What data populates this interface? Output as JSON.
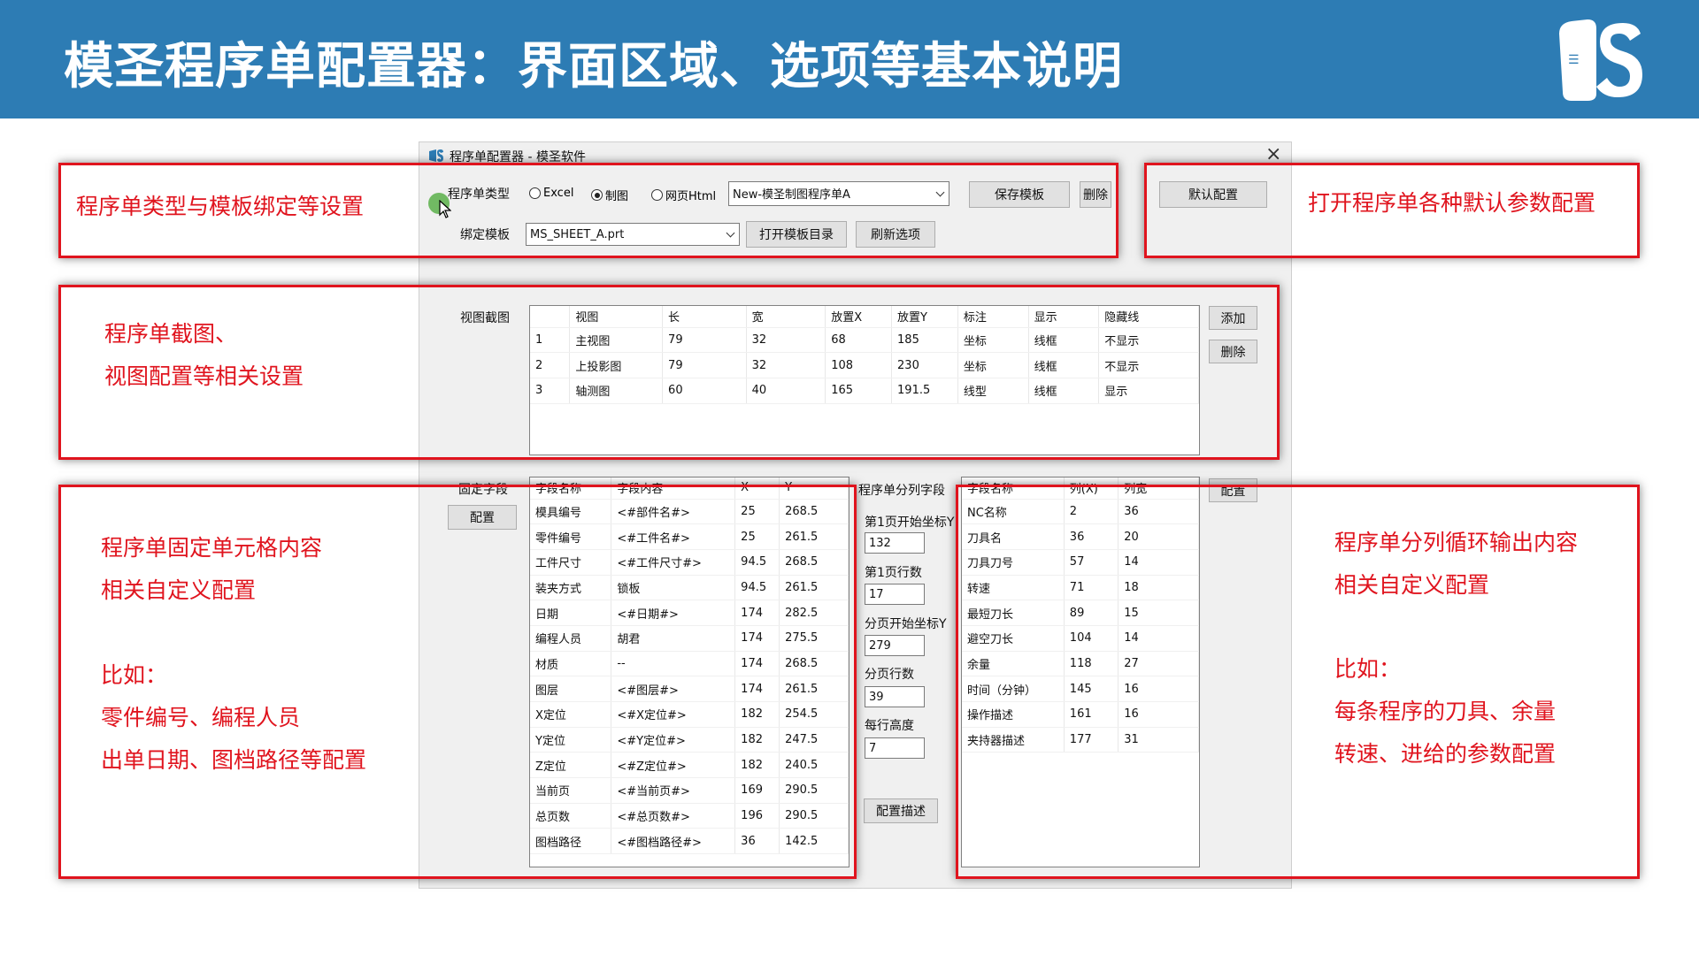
{
  "slide": {
    "title": "模圣程序单配置器：界面区域、选项等基本说明",
    "brand_color": "#2d7cb4",
    "highlight_color": "#e0141e"
  },
  "window": {
    "title": "程序单配置器 - 模圣软件",
    "close_glyph": "×",
    "sheet_type_label": "程序单类型",
    "radio_excel": "Excel",
    "radio_drawing": "制图",
    "radio_html": "网页Html",
    "selected_type": "制图",
    "template_name": "New-模圣制图程序单A",
    "save_template": "保存模板",
    "delete": "删除",
    "default_config": "默认配置",
    "bind_template_label": "绑定模板",
    "bind_template_value": "MS_SHEET_A.prt",
    "open_template_dir": "打开模板目录",
    "refresh_options": "刷新选项",
    "view_capture_label": "视图截图",
    "add": "添加",
    "delete2": "删除",
    "fixed_field_label": "固定字段",
    "config": "配置",
    "split_field_label": "程序单分列字段",
    "first_page_start_y_label": "第1页开始坐标Y",
    "first_page_start_y": "132",
    "first_page_rows_label": "第1页行数",
    "first_page_rows": "17",
    "page_start_y_label": "分页开始坐标Y",
    "page_start_y": "279",
    "page_rows_label": "分页行数",
    "page_rows": "39",
    "row_height_label": "每行高度",
    "row_height": "7",
    "config_desc": "配置描述",
    "config2": "配置"
  },
  "views_table": {
    "headers": [
      "",
      "视图",
      "长",
      "宽",
      "放置X",
      "放置Y",
      "标注",
      "显示",
      "隐藏线"
    ],
    "rows": [
      [
        "1",
        "主视图",
        "79",
        "32",
        "68",
        "185",
        "坐标",
        "线框",
        "不显示"
      ],
      [
        "2",
        "上投影图",
        "79",
        "32",
        "108",
        "230",
        "坐标",
        "线框",
        "不显示"
      ],
      [
        "3",
        "轴测图",
        "60",
        "40",
        "165",
        "191.5",
        "线型",
        "线框",
        "显示"
      ]
    ]
  },
  "fixed_table": {
    "headers": [
      "字段名称",
      "字段内容",
      "X",
      "Y"
    ],
    "rows": [
      [
        "模具编号",
        "<#部件名#>",
        "25",
        "268.5"
      ],
      [
        "零件编号",
        "<#工件名#>",
        "25",
        "261.5"
      ],
      [
        "工件尺寸",
        "<#工件尺寸#>",
        "94.5",
        "268.5"
      ],
      [
        "装夹方式",
        "锁板",
        "94.5",
        "261.5"
      ],
      [
        "日期",
        "<#日期#>",
        "174",
        "282.5"
      ],
      [
        "编程人员",
        "胡君",
        "174",
        "275.5"
      ],
      [
        "材质",
        "--",
        "174",
        "268.5"
      ],
      [
        "图层",
        "<#图层#>",
        "174",
        "261.5"
      ],
      [
        "X定位",
        "<#X定位#>",
        "182",
        "254.5"
      ],
      [
        "Y定位",
        "<#Y定位#>",
        "182",
        "247.5"
      ],
      [
        "Z定位",
        "<#Z定位#>",
        "182",
        "240.5"
      ],
      [
        "当前页",
        "<#当前页#>",
        "169",
        "290.5"
      ],
      [
        "总页数",
        "<#总页数#>",
        "196",
        "290.5"
      ],
      [
        "图档路径",
        "<#图档路径#>",
        "36",
        "142.5"
      ]
    ]
  },
  "split_table": {
    "headers": [
      "字段名称",
      "列(X)",
      "列宽"
    ],
    "rows": [
      [
        "NC名称",
        "2",
        "36"
      ],
      [
        "刀具名",
        "36",
        "20"
      ],
      [
        "刀具刀号",
        "57",
        "14"
      ],
      [
        "转速",
        "71",
        "18"
      ],
      [
        "最短刀长",
        "89",
        "15"
      ],
      [
        "避空刀长",
        "104",
        "14"
      ],
      [
        "余量",
        "118",
        "27"
      ],
      [
        "时间（分钟）",
        "145",
        "16"
      ],
      [
        "操作描述",
        "161",
        "16"
      ],
      [
        "夹持器描述",
        "177",
        "31"
      ]
    ]
  },
  "annotations": {
    "top_left": "程序单类型与模板绑定等设置",
    "top_right": "打开程序单各种默认参数配置",
    "mid_line1": "程序单截图、",
    "mid_line2": "视图配置等相关设置",
    "left_line1": "程序单固定单元格内容",
    "left_line2": "相关自定义配置",
    "left_line3": "比如：",
    "left_line4": "零件编号、编程人员",
    "left_line5": "出单日期、图档路径等配置",
    "right_line1": "程序单分列循环输出内容",
    "right_line2": "相关自定义配置",
    "right_line3": "比如：",
    "right_line4": "每条程序的刀具、余量",
    "right_line5": "转速、进给的参数配置"
  }
}
